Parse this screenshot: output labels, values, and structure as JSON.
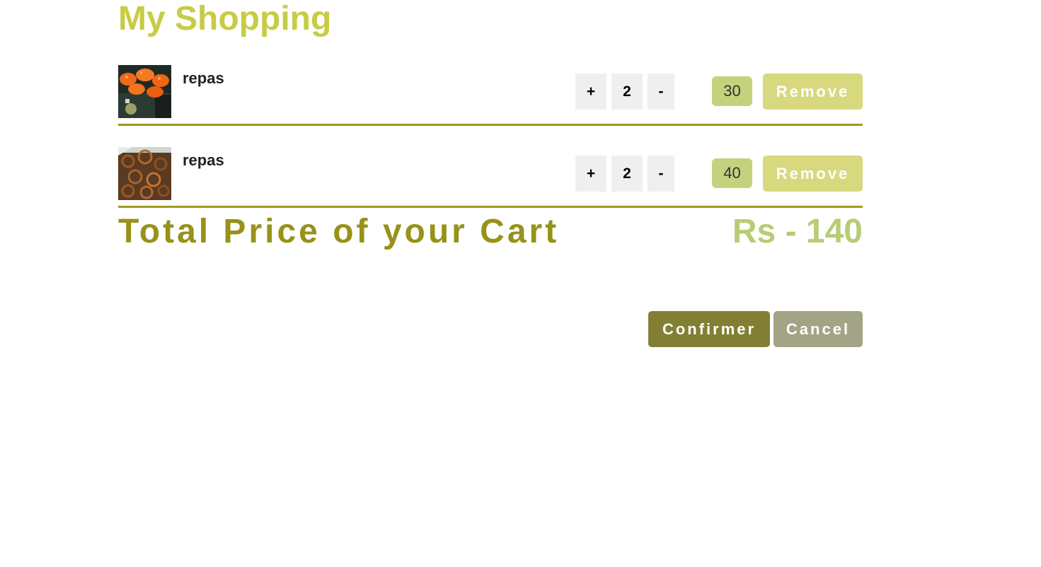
{
  "header": {
    "title": "My Shopping"
  },
  "cart": {
    "items": [
      {
        "name": "repas",
        "plus_label": "+",
        "quantity": "2",
        "minus_label": "-",
        "price": "30",
        "remove_label": "Remove",
        "image_icon": "sushi-thumbnail"
      },
      {
        "name": "repas",
        "plus_label": "+",
        "quantity": "2",
        "minus_label": "-",
        "price": "40",
        "remove_label": "Remove",
        "image_icon": "fried-dish-thumbnail"
      }
    ]
  },
  "total": {
    "label": "Total Price of your Cart",
    "value": "Rs - 140"
  },
  "actions": {
    "confirm_label": "Confirmer",
    "cancel_label": "Cancel"
  },
  "colors": {
    "title": "#c8cc45",
    "divider": "#9a9a1c",
    "price_badge": "#c6d17e",
    "remove_button": "#d8d87f",
    "total_label": "#979218",
    "total_value": "#b8cc75",
    "confirm_button": "#827f34",
    "cancel_button": "#a3a386"
  }
}
